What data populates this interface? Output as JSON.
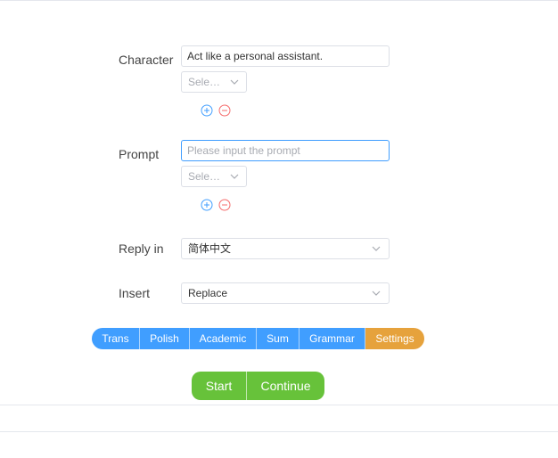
{
  "character": {
    "label": "Character",
    "value": "Act like a personal assistant.",
    "select_placeholder": "Sele…"
  },
  "prompt": {
    "label": "Prompt",
    "placeholder": "Please input the prompt",
    "select_placeholder": "Sele…"
  },
  "reply_in": {
    "label": "Reply in",
    "value": "简体中文"
  },
  "insert": {
    "label": "Insert",
    "value": "Replace"
  },
  "modes": [
    "Trans",
    "Polish",
    "Academic",
    "Sum",
    "Grammar",
    "Settings"
  ],
  "actions": {
    "start": "Start",
    "continue": "Continue"
  },
  "colors": {
    "primary": "#409eff",
    "warning": "#e6a23c",
    "success": "#67c23a",
    "danger": "#f56c6c"
  },
  "icons": {
    "add": "plus-circle-icon",
    "remove": "minus-circle-icon",
    "dropdown": "chevron-down-icon"
  }
}
